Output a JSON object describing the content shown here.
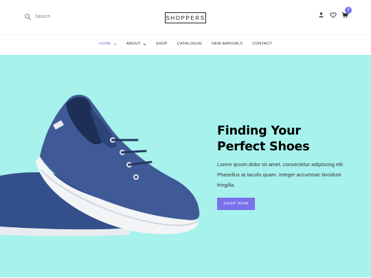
{
  "header": {
    "search_placeholder": "Search",
    "logo_text": "SHOPPERS",
    "cart_count": "2"
  },
  "nav": {
    "items": [
      {
        "label": "HOME",
        "has_dropdown": true,
        "active": true
      },
      {
        "label": "ABOUT",
        "has_dropdown": true,
        "active": false
      },
      {
        "label": "SHOP",
        "has_dropdown": false,
        "active": false
      },
      {
        "label": "CATALOGUE",
        "has_dropdown": false,
        "active": false
      },
      {
        "label": "NEW ARRIVALS",
        "has_dropdown": false,
        "active": false
      },
      {
        "label": "CONTACT",
        "has_dropdown": false,
        "active": false
      }
    ]
  },
  "hero": {
    "title_line1": "Finding Your",
    "title_line2": "Perfect Shoes",
    "body": "Lorem ipsum dolor sit amet, consectetur adipiscing elit. Phasellus at iaculis quam. Integer accumsan tincidunt fringilla.",
    "button_label": "SHOP NOW"
  },
  "colors": {
    "accent": "#7971ea",
    "hero_background": "#a7f2ec",
    "text_dark": "#000000",
    "shoe_body": "#3f5a96"
  },
  "icons": [
    "search-icon",
    "user-icon",
    "heart-icon",
    "cart-icon",
    "chevron-down-icon"
  ]
}
